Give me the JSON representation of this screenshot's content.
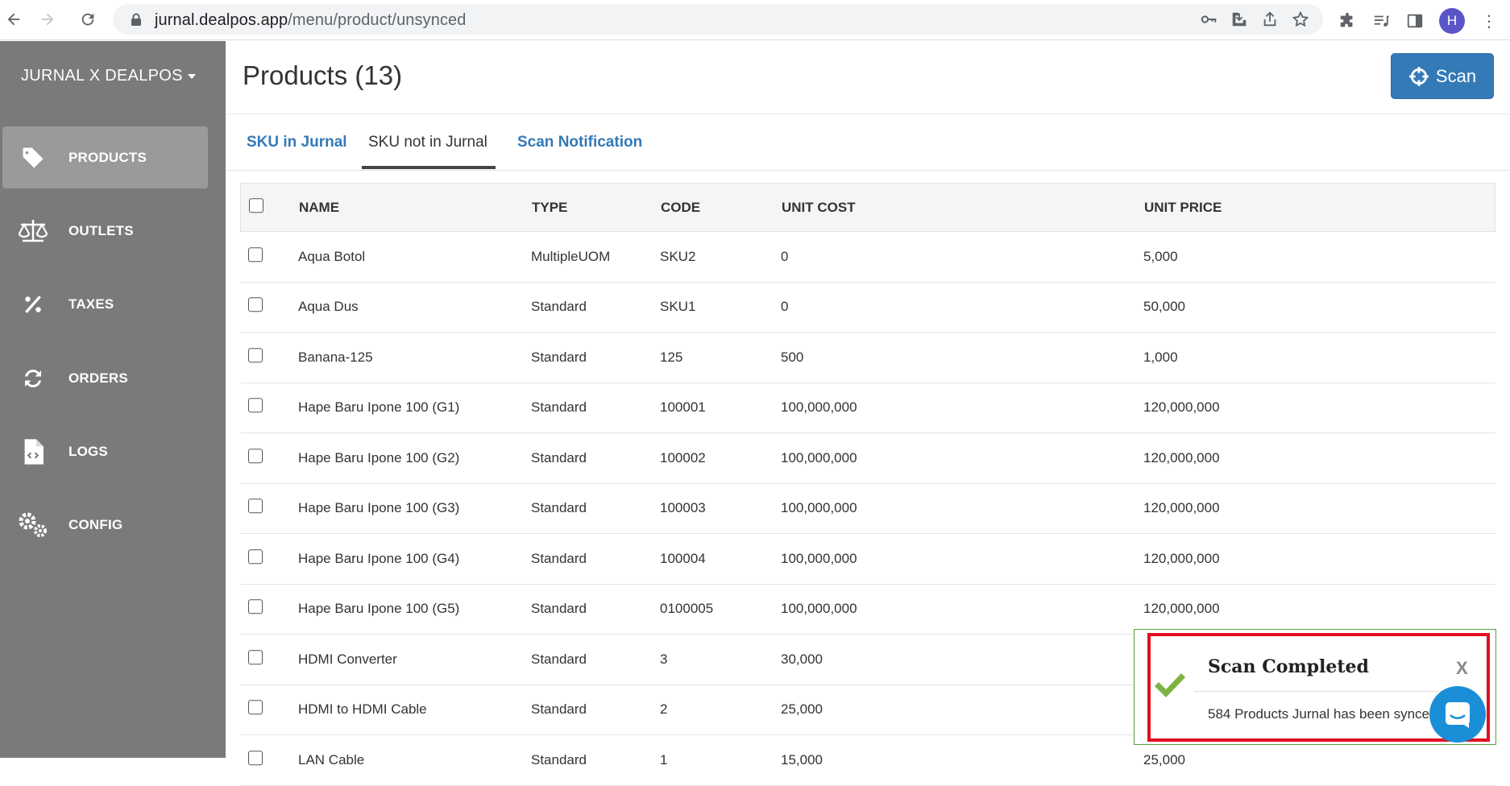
{
  "browser": {
    "url_host": "jurnal.dealpos.app",
    "url_path": "/menu/product/unsynced",
    "avatar_letter": "H"
  },
  "sidebar": {
    "brand": "JURNAL X DEALPOS",
    "items": [
      {
        "label": "PRODUCTS",
        "icon": "tag-icon",
        "active": true
      },
      {
        "label": "OUTLETS",
        "icon": "scale-icon"
      },
      {
        "label": "TAXES",
        "icon": "percent-icon"
      },
      {
        "label": "ORDERS",
        "icon": "sync-icon"
      },
      {
        "label": "LOGS",
        "icon": "code-file-icon"
      },
      {
        "label": "CONFIG",
        "icon": "gears-icon"
      }
    ]
  },
  "header": {
    "title": "Products (13)",
    "scan_label": "Scan"
  },
  "tabs": [
    {
      "label": "SKU in Jurnal"
    },
    {
      "label": "SKU not in Jurnal",
      "active": true
    },
    {
      "label": "Scan Notification"
    }
  ],
  "table": {
    "columns": [
      "NAME",
      "TYPE",
      "CODE",
      "UNIT COST",
      "UNIT PRICE"
    ],
    "rows": [
      {
        "name": "Aqua Botol",
        "type": "MultipleUOM",
        "code": "SKU2",
        "cost": "0",
        "price": "5,000"
      },
      {
        "name": "Aqua Dus",
        "type": "Standard",
        "code": "SKU1",
        "cost": "0",
        "price": "50,000"
      },
      {
        "name": "Banana-125",
        "type": "Standard",
        "code": "125",
        "cost": "500",
        "price": "1,000"
      },
      {
        "name": "Hape Baru Ipone 100 (G1)",
        "type": "Standard",
        "code": "100001",
        "cost": "100,000,000",
        "price": "120,000,000"
      },
      {
        "name": "Hape Baru Ipone 100 (G2)",
        "type": "Standard",
        "code": "100002",
        "cost": "100,000,000",
        "price": "120,000,000"
      },
      {
        "name": "Hape Baru Ipone 100 (G3)",
        "type": "Standard",
        "code": "100003",
        "cost": "100,000,000",
        "price": "120,000,000"
      },
      {
        "name": "Hape Baru Ipone 100 (G4)",
        "type": "Standard",
        "code": "100004",
        "cost": "100,000,000",
        "price": "120,000,000"
      },
      {
        "name": "Hape Baru Ipone 100 (G5)",
        "type": "Standard",
        "code": "0100005",
        "cost": "100,000,000",
        "price": "120,000,000"
      },
      {
        "name": "HDMI Converter",
        "type": "Standard",
        "code": "3",
        "cost": "30,000",
        "price": ""
      },
      {
        "name": "HDMI to HDMI Cable",
        "type": "Standard",
        "code": "2",
        "cost": "25,000",
        "price": ""
      },
      {
        "name": "LAN Cable",
        "type": "Standard",
        "code": "1",
        "cost": "15,000",
        "price": "25,000"
      }
    ]
  },
  "toast": {
    "title": "Scan Completed",
    "close": "X",
    "message": "584 Products Jurnal has been synced"
  },
  "colors": {
    "sidebar_bg": "#7a7a7a",
    "primary": "#337ab7",
    "success": "#5aa040",
    "highlight": "#e01020"
  }
}
